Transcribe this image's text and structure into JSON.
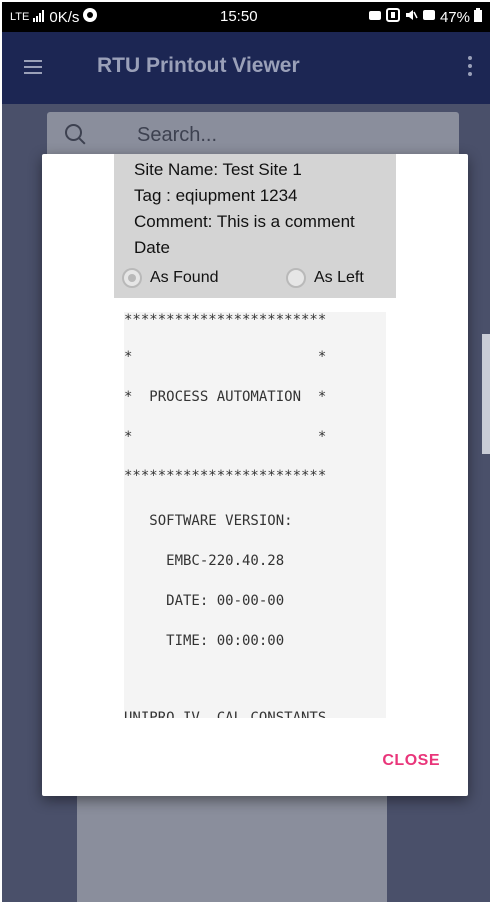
{
  "status_bar": {
    "network": "LTE",
    "speed": "0K/s",
    "time": "15:50",
    "battery": "47%"
  },
  "app_bar": {
    "title": "RTU Printout Viewer",
    "menu_icon": "hamburger-menu-icon",
    "overflow_icon": "more-vert-icon"
  },
  "background": {
    "search_placeholder": "Search..."
  },
  "dialog": {
    "site_name": "Site Name: Test Site 1",
    "tag": "Tag : eqiupment 1234",
    "comment": "Comment: This is a comment",
    "date": "Date",
    "radio_options": [
      {
        "label": "As Found",
        "selected": true
      },
      {
        "label": "As Left",
        "selected": false
      }
    ],
    "printout_lines": [
      "************************",
      "*                      *",
      "*  PROCESS AUTOMATION  *",
      "*                      *",
      "************************",
      "   SOFTWARE VERSION:",
      "     EMBC-220.40.28",
      "     DATE: 00-00-00",
      "     TIME: 00:00:00",
      "UNIPRO IV  CAL CONSTANTS"
    ],
    "close_label": "CLOSE",
    "accent_color": "#e9357a"
  }
}
